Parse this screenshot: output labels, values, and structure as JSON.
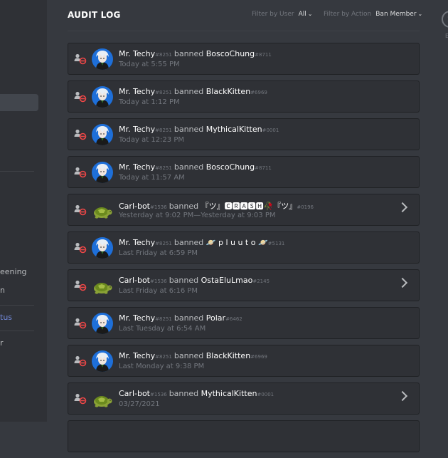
{
  "sidebar": {
    "items": [
      {
        "label": "eening"
      },
      {
        "label": "n"
      },
      {
        "label": "tus"
      },
      {
        "label": "r"
      }
    ]
  },
  "header": {
    "title": "AUDIT LOG",
    "filter_user_label": "Filter by User",
    "filter_user_value": "All",
    "filter_action_label": "Filter by Action",
    "filter_action_value": "Ban Member",
    "esc_label": "E"
  },
  "entries": [
    {
      "user": "Mr. Techy",
      "user_disc": "#8251",
      "action": "banned",
      "target": "BoscoChung",
      "target_disc": "#8711",
      "time": "Today at 5:55 PM",
      "avatar": "anime",
      "expandable": false
    },
    {
      "user": "Mr. Techy",
      "user_disc": "#8251",
      "action": "banned",
      "target": "BlackKitten",
      "target_disc": "#6969",
      "time": "Today at 1:12 PM",
      "avatar": "anime",
      "expandable": false
    },
    {
      "user": "Mr. Techy",
      "user_disc": "#8251",
      "action": "banned",
      "target": "MythicalKitten",
      "target_disc": "#0001",
      "time": "Today at 12:23 PM",
      "avatar": "anime",
      "expandable": false
    },
    {
      "user": "Mr. Techy",
      "user_disc": "#8251",
      "action": "banned",
      "target": "BoscoChung",
      "target_disc": "#8711",
      "time": "Today at 11:57 AM",
      "avatar": "anime",
      "expandable": false
    },
    {
      "user": "Carl-bot",
      "user_disc": "#1536",
      "action": "banned",
      "target": "『ツ』🅲🆁🅰🆂🅷🥀『ツ』",
      "target_disc": "#0196",
      "time": "Yesterday at 9:02 PM—Yesterday at 9:03 PM",
      "avatar": "turtle",
      "expandable": true
    },
    {
      "user": "Mr. Techy",
      "user_disc": "#8251",
      "action": "banned",
      "target": "🪐 p l u u t o 🪐",
      "target_disc": "#5131",
      "time": "Last Friday at 6:59 PM",
      "avatar": "anime",
      "expandable": false
    },
    {
      "user": "Carl-bot",
      "user_disc": "#1536",
      "action": "banned",
      "target": "OstaEluLmao",
      "target_disc": "#2145",
      "time": "Last Friday at 6:16 PM",
      "avatar": "turtle",
      "expandable": true
    },
    {
      "user": "Mr. Techy",
      "user_disc": "#8251",
      "action": "banned",
      "target": "Polar",
      "target_disc": "#6462",
      "time": "Last Tuesday at 6:54 AM",
      "avatar": "anime",
      "expandable": false
    },
    {
      "user": "Mr. Techy",
      "user_disc": "#8251",
      "action": "banned",
      "target": "BlackKitten",
      "target_disc": "#6969",
      "time": "Last Monday at 9:38 PM",
      "avatar": "anime",
      "expandable": false
    },
    {
      "user": "Carl-bot",
      "user_disc": "#1536",
      "action": "banned",
      "target": "MythicalKitten",
      "target_disc": "#0001",
      "time": "03/27/2021",
      "avatar": "turtle",
      "expandable": true
    },
    {
      "user": "",
      "user_disc": "",
      "action": "",
      "target": "",
      "target_disc": "",
      "time": "",
      "avatar": "none",
      "expandable": false
    }
  ],
  "colors": {
    "background": "#36393f",
    "card": "#2f3136",
    "ban_red": "#f04747",
    "link_blue": "#7289da"
  }
}
